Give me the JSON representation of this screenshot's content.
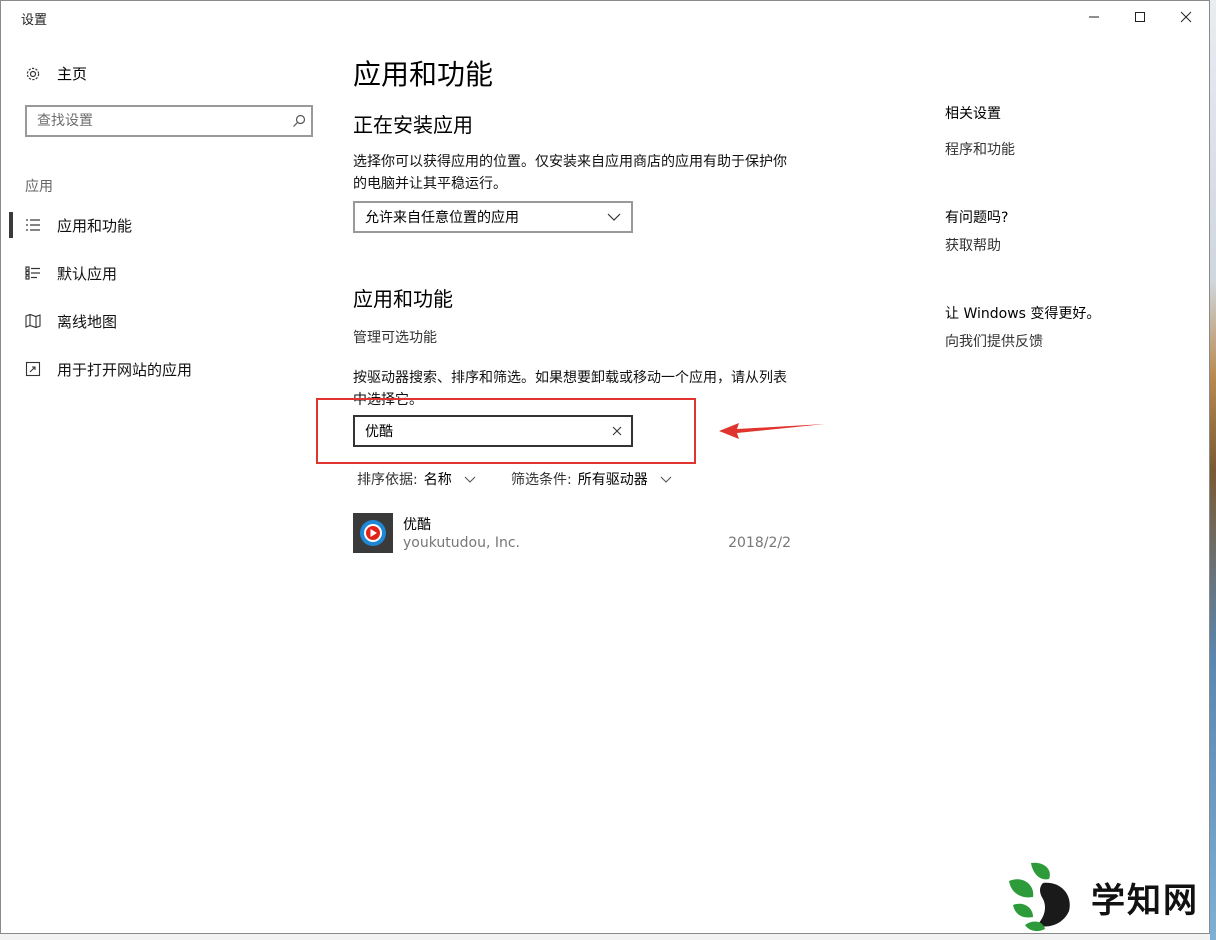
{
  "window": {
    "title": "设置"
  },
  "sidebar": {
    "home_label": "主页",
    "search_placeholder": "查找设置",
    "section_label": "应用",
    "items": [
      {
        "label": "应用和功能",
        "icon": "list-icon",
        "active": true
      },
      {
        "label": "默认应用",
        "icon": "default-apps-icon",
        "active": false
      },
      {
        "label": "离线地图",
        "icon": "map-icon",
        "active": false
      },
      {
        "label": "用于打开网站的应用",
        "icon": "open-website-icon",
        "active": false
      }
    ]
  },
  "main": {
    "page_title": "应用和功能",
    "install_heading": "正在安装应用",
    "install_desc": "选择你可以获得应用的位置。仅安装来自应用商店的应用有助于保护你的电脑并让其平稳运行。",
    "install_dropdown_value": "允许来自任意位置的应用",
    "apps_heading": "应用和功能",
    "manage_optional": "管理可选功能",
    "apps_desc": "按驱动器搜索、排序和筛选。如果想要卸载或移动一个应用，请从列表中选择它。",
    "search_value": "优酷",
    "sort_label": "排序依据:",
    "sort_value": "名称",
    "filter_label": "筛选条件:",
    "filter_value": "所有驱动器",
    "apps": [
      {
        "name": "优酷",
        "publisher": "youkutudou, Inc.",
        "date": "2018/2/2"
      }
    ]
  },
  "right_pane": {
    "related_heading": "相关设置",
    "related_link": "程序和功能",
    "question_heading": "有问题吗?",
    "help_link": "获取帮助",
    "feedback_heading": "让 Windows 变得更好。",
    "feedback_link": "向我们提供反馈"
  },
  "annotation": {
    "highlight_color": "#e0342f"
  },
  "watermark": {
    "text": "学知网"
  }
}
